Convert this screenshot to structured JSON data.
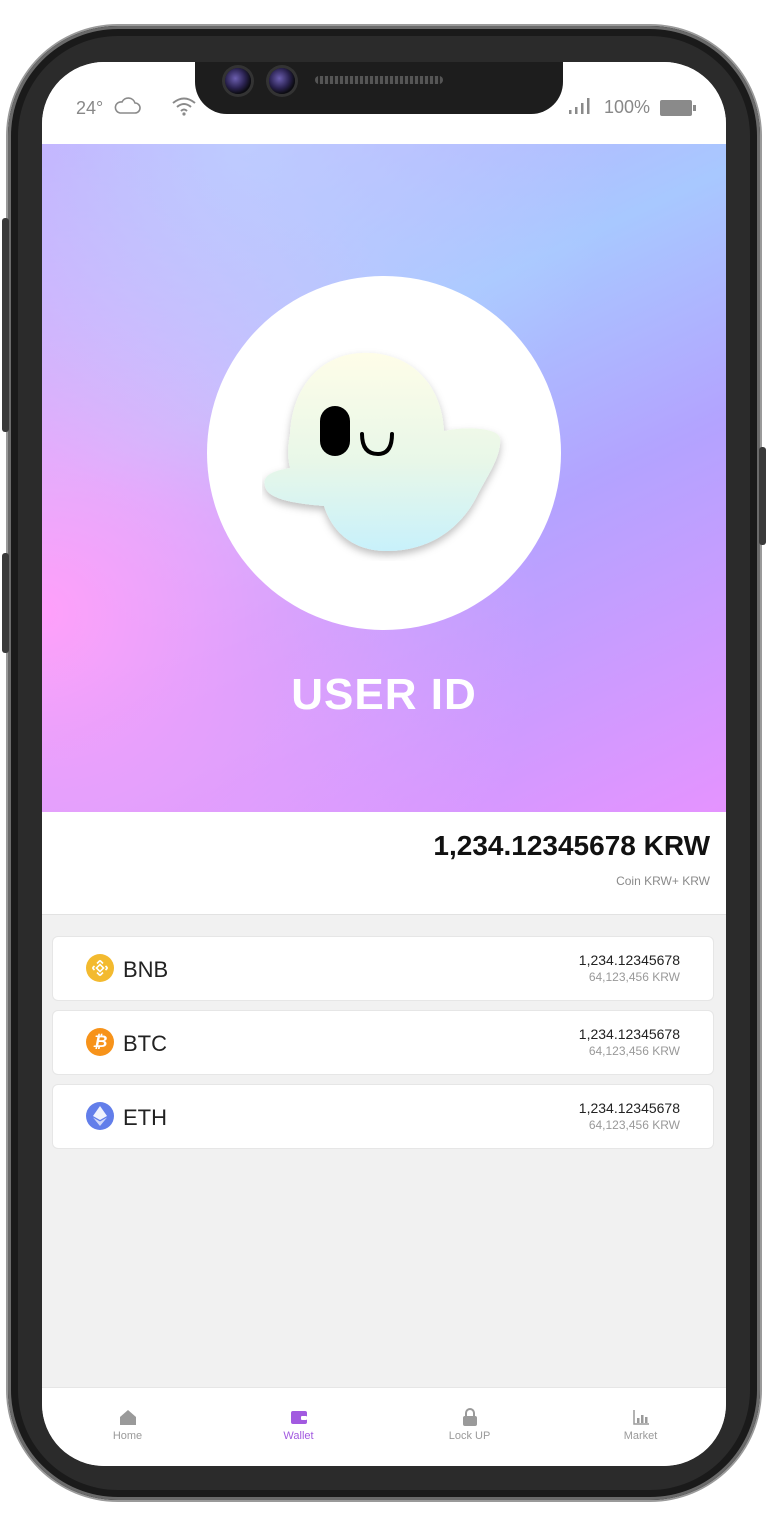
{
  "status_bar": {
    "temperature": "24°",
    "battery": "100%",
    "icons": [
      "cloud-icon",
      "wifi-icon",
      "signal-icon",
      "battery-icon"
    ]
  },
  "profile": {
    "user_id": "USER ID",
    "avatar": "ghost-avatar"
  },
  "balance": {
    "amount": "1,234.12345678 KRW",
    "caption": "Coin KRW+ KRW"
  },
  "coins": [
    {
      "symbol": "BNB",
      "amount": "1,234.12345678",
      "krw": "64,123,456 KRW",
      "icon": "bnb-icon",
      "color": "#F3BA2F"
    },
    {
      "symbol": "BTC",
      "amount": "1,234.12345678",
      "krw": "64,123,456 KRW",
      "icon": "btc-icon",
      "color": "#F7931A"
    },
    {
      "symbol": "ETH",
      "amount": "1,234.12345678",
      "krw": "64,123,456 KRW",
      "icon": "eth-icon",
      "color": "#627EEA"
    }
  ],
  "nav": [
    {
      "label": "Home",
      "icon": "home-icon",
      "active": false
    },
    {
      "label": "Wallet",
      "icon": "wallet-icon",
      "active": true
    },
    {
      "label": "Lock UP",
      "icon": "lock-icon",
      "active": false
    },
    {
      "label": "Market",
      "icon": "chart-icon",
      "active": false
    }
  ],
  "colors": {
    "accent": "#A25AE0",
    "inactive": "#9A9A9A"
  }
}
